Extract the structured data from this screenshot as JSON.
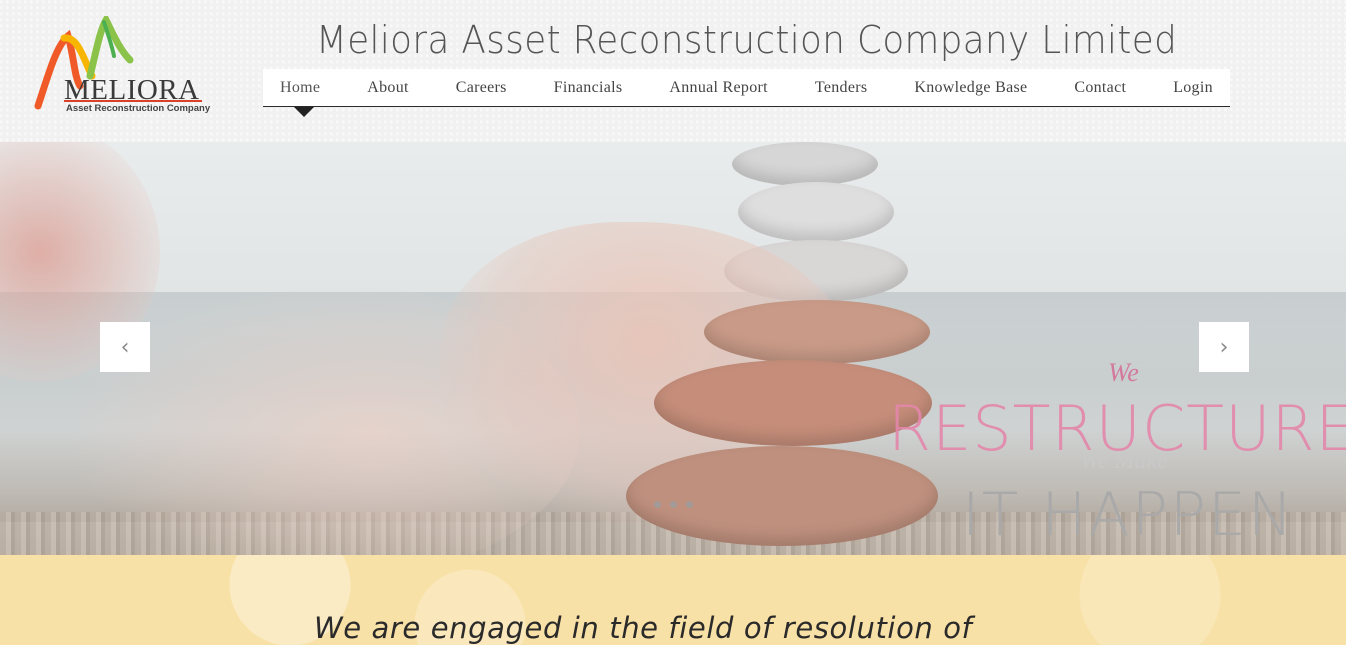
{
  "header": {
    "logo": {
      "wordmark": "MELIORA",
      "subtitle": "Asset Reconstruction Company"
    },
    "site_title": "Meliora Asset Reconstruction Company Limited",
    "nav": [
      {
        "label": "Home",
        "active": true
      },
      {
        "label": "About"
      },
      {
        "label": "Careers"
      },
      {
        "label": "Financials"
      },
      {
        "label": "Annual Report"
      },
      {
        "label": "Tenders"
      },
      {
        "label": "Knowledge Base"
      },
      {
        "label": "Contact"
      },
      {
        "label": "Login"
      }
    ]
  },
  "slider": {
    "prev_icon": "chevron-left-icon",
    "next_icon": "chevron-right-icon",
    "prev_glyph": "‹",
    "next_glyph": "›",
    "slide_count": 3,
    "tagline": {
      "we": "We",
      "restructure": "RESTRUCTURE",
      "we_make": "We Make",
      "it_happen": "IT HAPPEN"
    }
  },
  "intro": {
    "text": "We are engaged in the field of resolution of"
  },
  "colors": {
    "accent_pink": "#e487ab",
    "intro_bg": "#f8e1a6",
    "logo_red": "#d9412b"
  }
}
